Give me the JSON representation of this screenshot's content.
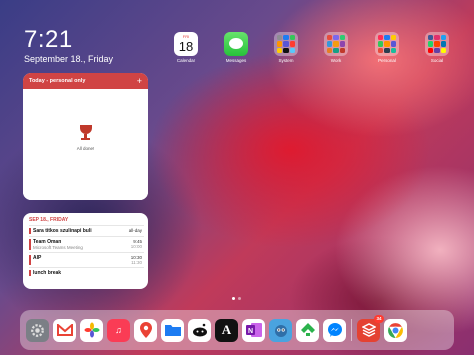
{
  "clock": {
    "time": "7:21",
    "date": "September 18., Friday"
  },
  "top_apps": [
    {
      "label": "Calendar",
      "icon": "calendar-icon",
      "day_abbr": "FRI",
      "day_num": "18"
    },
    {
      "label": "Messages",
      "icon": "messages-icon"
    },
    {
      "label": "System",
      "icon": "folder-icon"
    },
    {
      "label": "Work",
      "icon": "folder-icon"
    },
    {
      "label": "Personal",
      "icon": "folder-icon"
    },
    {
      "label": "Social",
      "icon": "folder-icon"
    }
  ],
  "todo_widget": {
    "title": "Today - personal only",
    "add": "+",
    "empty_text": "All done!"
  },
  "calendar_widget": {
    "header": "SEP 18., FRIDAY",
    "events": [
      {
        "title": "Sara titkos szulinapi buli",
        "subtitle": "",
        "start": "all-day",
        "end": ""
      },
      {
        "title": "Team Oman",
        "subtitle": "Microsoft Teams Meeting",
        "start": "9:45",
        "end": "10:00"
      },
      {
        "title": "AIP",
        "subtitle": "",
        "start": "10:30",
        "end": "11:30"
      },
      {
        "title": "lunch break",
        "subtitle": "",
        "start": "",
        "end": ""
      }
    ]
  },
  "dock": [
    {
      "name": "settings-icon",
      "color": "#7b7f86"
    },
    {
      "name": "gmail-icon",
      "color": "#ffffff"
    },
    {
      "name": "photos-icon",
      "color": "#ffffff"
    },
    {
      "name": "music-icon",
      "color": "#fa3c55"
    },
    {
      "name": "google-maps-icon",
      "color": "#ffffff"
    },
    {
      "name": "files-icon",
      "color": "#1d7cf2"
    },
    {
      "name": "reddit-icon",
      "color": "#ffffff"
    },
    {
      "name": "font-app-icon",
      "color": "#111111"
    },
    {
      "name": "onenote-icon",
      "color": "#ffffff"
    },
    {
      "name": "tweetbot-icon",
      "color": "#4aa3df"
    },
    {
      "name": "feedly-icon",
      "color": "#ffffff"
    },
    {
      "name": "messenger-icon",
      "color": "#ffffff"
    },
    {
      "name": "todoist-icon",
      "color": "#e44232",
      "badge": "34"
    },
    {
      "name": "chrome-icon",
      "color": "#ffffff"
    }
  ]
}
